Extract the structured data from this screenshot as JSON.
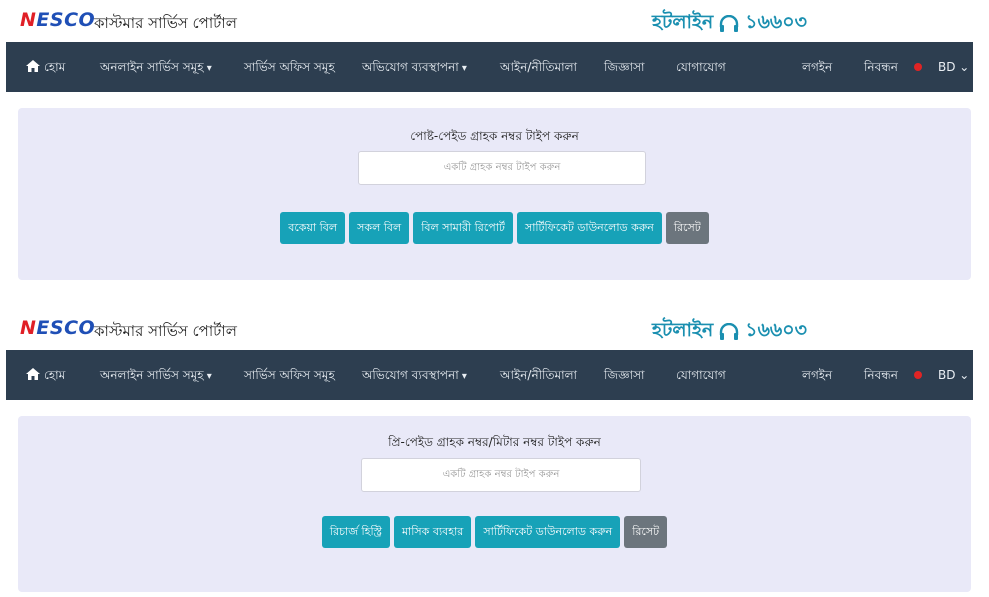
{
  "header": {
    "logo_text_first": "N",
    "logo_text_rest": "ESCO",
    "portal_title": "কাস্টমার সার্ভিস পোর্টাল",
    "hotline_label": "হটলাইন",
    "hotline_number": "১৬৬০৩"
  },
  "nav": {
    "home": "হোম",
    "online_services": "অনলাইন সার্ভিস সমূহ",
    "service_offices": "সার্ভিস অফিস সমূহ",
    "complaints": "অভিযোগ ব্যবস্থাপনা",
    "law": "আইন/নীতিমালা",
    "faq": "জিজ্ঞাসা",
    "contact": "যোগাযোগ",
    "login": "লগইন",
    "register": "নিবন্ধন",
    "lang": "BD"
  },
  "postpaid": {
    "prompt": "পোষ্ট-পেইড গ্রাহক নম্বর টাইপ করুন",
    "placeholder": "একটি গ্রাহক নম্বর টাইপ করুন",
    "buttons": [
      "বকেয়া বিল",
      "সকল বিল",
      "বিল সামারী রিপোর্ট",
      "সার্টিফিকেট ডাউনলোড করুন"
    ],
    "reset": "রিসেট"
  },
  "prepaid": {
    "prompt": "প্রি-পেইড গ্রাহক নম্বর/মিটার নম্বর টাইপ করুন",
    "placeholder": "একটি গ্রাহক নম্বর টাইপ করুন",
    "buttons": [
      "রিচার্জ হিস্ট্রি",
      "মাসিক ব্যবহার",
      "সার্টিফিকেট ডাউনলোড করুন"
    ],
    "reset": "রিসেট"
  },
  "colors": {
    "navbar": "#2d3e50",
    "panel": "#e9e9f8",
    "button_primary": "#17a2b8",
    "button_reset": "#6c757d",
    "hotline": "#1a8fb0",
    "logo_red": "#e01f26",
    "logo_blue": "#1f4fb6"
  }
}
